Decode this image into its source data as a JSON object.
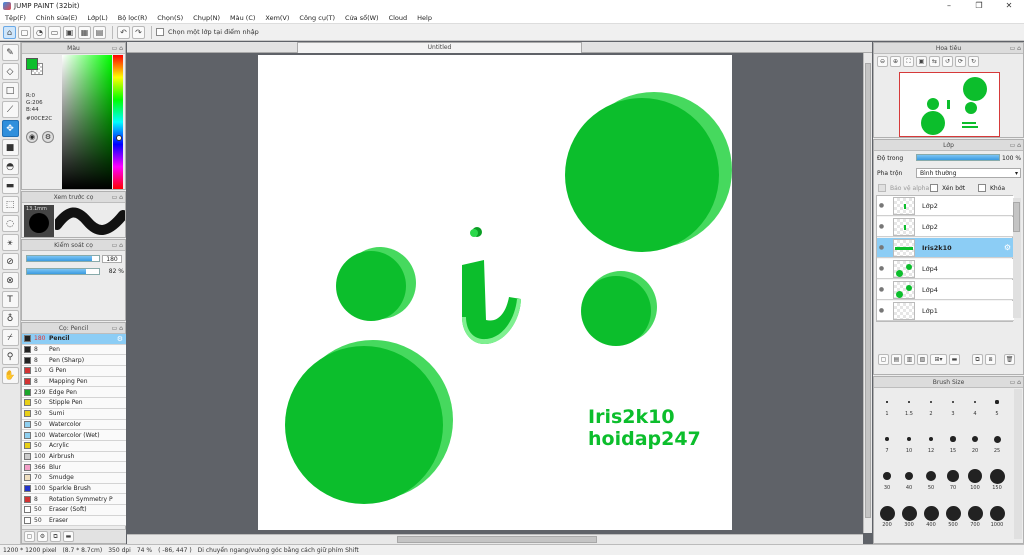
{
  "app": {
    "title": "JUMP PAINT (32bit)"
  },
  "menu": [
    "Tệp(F)",
    "Chỉnh sửa(E)",
    "Lớp(L)",
    "Bộ lọc(R)",
    "Chọn(S)",
    "Chụp(N)",
    "Màu (C)",
    "Xem(V)",
    "Công cụ(T)",
    "Cửa sổ(W)",
    "Cloud",
    "Help"
  ],
  "toolbar": {
    "snap_label": "Chọn một lớp tại điểm nhập"
  },
  "colors": {
    "main": "#0CBE2C",
    "accent": "#2f8fdc"
  },
  "color_panel": {
    "title": "Màu",
    "r": "R:0",
    "g": "G:206",
    "b": "B:44",
    "hex": "#00CE2C"
  },
  "brush_preview": {
    "title": "Xem trước cọ",
    "size": "13.1mm"
  },
  "brush_control": {
    "title": "Kiểm soát cọ",
    "size_value": "180",
    "opacity_value": "82 %",
    "size_frac": 0.9,
    "opacity_frac": 0.82
  },
  "brush_list": {
    "title": "Cọ: Pencil",
    "items": [
      {
        "num": "180",
        "name": "Pencil",
        "color": "#222222",
        "selected": true
      },
      {
        "num": "8",
        "name": "Pen",
        "color": "#222222"
      },
      {
        "num": "8",
        "name": "Pen (Sharp)",
        "color": "#222222"
      },
      {
        "num": "10",
        "name": "G Pen",
        "color": "#d33333"
      },
      {
        "num": "8",
        "name": "Mapping Pen",
        "color": "#d33333"
      },
      {
        "num": "239",
        "name": "Edge Pen",
        "color": "#1aa52a"
      },
      {
        "num": "50",
        "name": "Stipple Pen",
        "color": "#e8d018"
      },
      {
        "num": "30",
        "name": "Sumi",
        "color": "#e8d018"
      },
      {
        "num": "50",
        "name": "Watercolor",
        "color": "#8fd0f0"
      },
      {
        "num": "100",
        "name": "Watercolor (Wet)",
        "color": "#8fd0f0"
      },
      {
        "num": "50",
        "name": "Acrylic",
        "color": "#e8d018"
      },
      {
        "num": "100",
        "name": "Airbrush",
        "color": "#cccccc"
      },
      {
        "num": "366",
        "name": "Blur",
        "color": "#f4a0c8"
      },
      {
        "num": "70",
        "name": "Smudge",
        "color": "#f0e0c0"
      },
      {
        "num": "100",
        "name": "Sparkle Brush",
        "color": "#2233cc"
      },
      {
        "num": "8",
        "name": "Rotation Symmetry P",
        "color": "#d33333"
      },
      {
        "num": "50",
        "name": "Eraser (Soft)",
        "color": "#ffffff"
      },
      {
        "num": "50",
        "name": "Eraser",
        "color": "#ffffff"
      }
    ]
  },
  "canvas": {
    "tab_title": "Untitled",
    "text_line1": "Iris2k10",
    "text_line2": "hoidap247"
  },
  "navigator": {
    "title": "Hoa tiêu"
  },
  "layer_panel": {
    "title": "Lớp",
    "opacity_label": "Độ trong",
    "opacity_value": "100 %",
    "opacity_frac": 1.0,
    "blend_label": "Pha trộn",
    "blend_value": "Bình thường",
    "protect_alpha": "Bảo vệ alpha",
    "clip": "Xén bớt",
    "lock": "Khóa",
    "layers": [
      {
        "name": "Lớp2",
        "selected": false
      },
      {
        "name": "Lớp2",
        "selected": false
      },
      {
        "name": "Iris2k10",
        "selected": true
      },
      {
        "name": "Lớp4",
        "selected": false
      },
      {
        "name": "Lớp4",
        "selected": false
      },
      {
        "name": "Lớp1",
        "selected": false
      }
    ]
  },
  "brush_size": {
    "title": "Brush Size",
    "sizes": [
      "1",
      "1.5",
      "2",
      "3",
      "4",
      "5",
      "7",
      "10",
      "12",
      "15",
      "20",
      "25",
      "30",
      "40",
      "50",
      "70",
      "100",
      "150",
      "200",
      "300",
      "400",
      "500",
      "700",
      "1000"
    ]
  },
  "status": {
    "dimensions": "1200 * 1200 pixel",
    "physical": "(8.7 * 8.7cm)",
    "dpi": "350 dpi",
    "zoom": "74 %",
    "coords": "( -86, 447 )",
    "hint": "Di chuyển ngang/vuông góc bằng cách giữ phím Shift"
  }
}
